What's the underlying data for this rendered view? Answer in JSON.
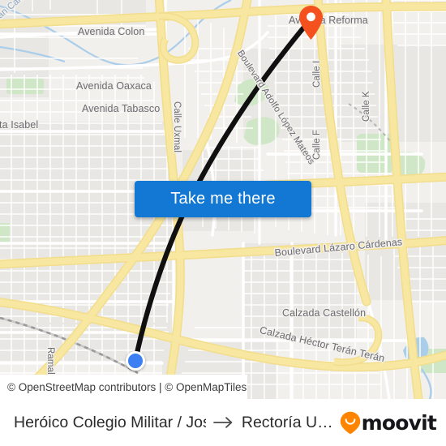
{
  "app": {
    "brand": "moovit",
    "brand_pin_color": "#ff8400"
  },
  "map": {
    "attribution": "© OpenStreetMap contributors | © OpenMapTiles",
    "origin_marker_name": "current-location",
    "destination_marker_name": "destination-pin",
    "colors": {
      "background": "#eceae6",
      "land": "#f2f0ec",
      "highway": "#f8e7a0",
      "highway_casing": "#f2dd8c",
      "road": "#ffffff",
      "park": "#cfe7c6",
      "water": "#aacdea",
      "route_line": "#101010",
      "origin_dot": "#3b7ff2",
      "destination_pin": "#f4511e",
      "label_text": "#6b6b72",
      "water_label_text": "#8ea6c4"
    },
    "labels": [
      {
        "text": "can Canal",
        "kind": "water"
      },
      {
        "text": "Avenida Colon",
        "kind": "street"
      },
      {
        "text": "Avenida Oaxaca",
        "kind": "street"
      },
      {
        "text": "Avenida Tabasco",
        "kind": "street"
      },
      {
        "text": "nta Isabel",
        "kind": "street"
      },
      {
        "text": "Avenida Reforma",
        "kind": "street"
      },
      {
        "text": "Boulevard Adolfo López Mateos",
        "kind": "street"
      },
      {
        "text": "Calle Uxmal",
        "kind": "street"
      },
      {
        "text": "Calle I",
        "kind": "street"
      },
      {
        "text": "Calle F",
        "kind": "street"
      },
      {
        "text": "Calle K",
        "kind": "street"
      },
      {
        "text": "Boulevard Lázaro Cárdenas",
        "kind": "street"
      },
      {
        "text": "Calzada Castellón",
        "kind": "street"
      },
      {
        "text": "Calzada Héctor Terán Terán",
        "kind": "street"
      },
      {
        "text": "Ramal a",
        "kind": "street"
      }
    ]
  },
  "cta": {
    "take_me_there_label": "Take me there"
  },
  "route": {
    "origin": "Heróico Colegio Militar / José Marian…",
    "destination": "Rectoría U…",
    "arrow": "→"
  }
}
